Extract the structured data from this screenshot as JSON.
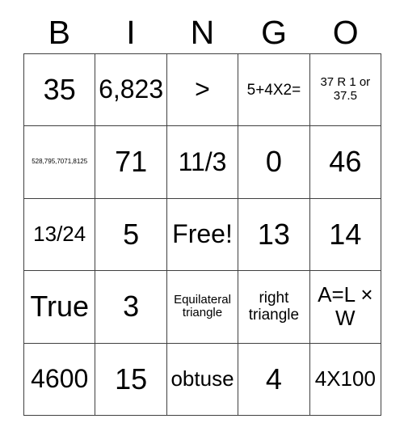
{
  "card": {
    "title": "BINGO",
    "headers": [
      "B",
      "I",
      "N",
      "G",
      "O"
    ],
    "free_space_label": "Free!",
    "colors": {
      "background": "#ffffff",
      "text": "#000000",
      "border": "#404040"
    },
    "rows": [
      [
        {
          "text": "35",
          "size": "xl"
        },
        {
          "text": "6,823",
          "size": "lg"
        },
        {
          "text": ">",
          "size": "lg"
        },
        {
          "text": "5+4X2=",
          "size": "sm"
        },
        {
          "text": "37 R 1 or 37.5",
          "size": "xs"
        }
      ],
      [
        {
          "text": "528,795,7071,8125",
          "size": "xxs"
        },
        {
          "text": "71",
          "size": "xl"
        },
        {
          "text": "11/3",
          "size": "lg"
        },
        {
          "text": "0",
          "size": "xl"
        },
        {
          "text": "46",
          "size": "xl"
        }
      ],
      [
        {
          "text": "13/24",
          "size": "md"
        },
        {
          "text": "5",
          "size": "xl"
        },
        {
          "text": "Free!",
          "size": "lg"
        },
        {
          "text": "13",
          "size": "xl"
        },
        {
          "text": "14",
          "size": "xl"
        }
      ],
      [
        {
          "text": "True",
          "size": "xl"
        },
        {
          "text": "3",
          "size": "xl"
        },
        {
          "text": "Equilateral triangle",
          "size": "xs"
        },
        {
          "text": "right triangle",
          "size": "sm"
        },
        {
          "text": "A=L × W",
          "size": "md"
        }
      ],
      [
        {
          "text": "4600",
          "size": "lg"
        },
        {
          "text": "15",
          "size": "xl"
        },
        {
          "text": "obtuse",
          "size": "md"
        },
        {
          "text": "4",
          "size": "xl"
        },
        {
          "text": "4X100",
          "size": "md"
        }
      ]
    ]
  }
}
